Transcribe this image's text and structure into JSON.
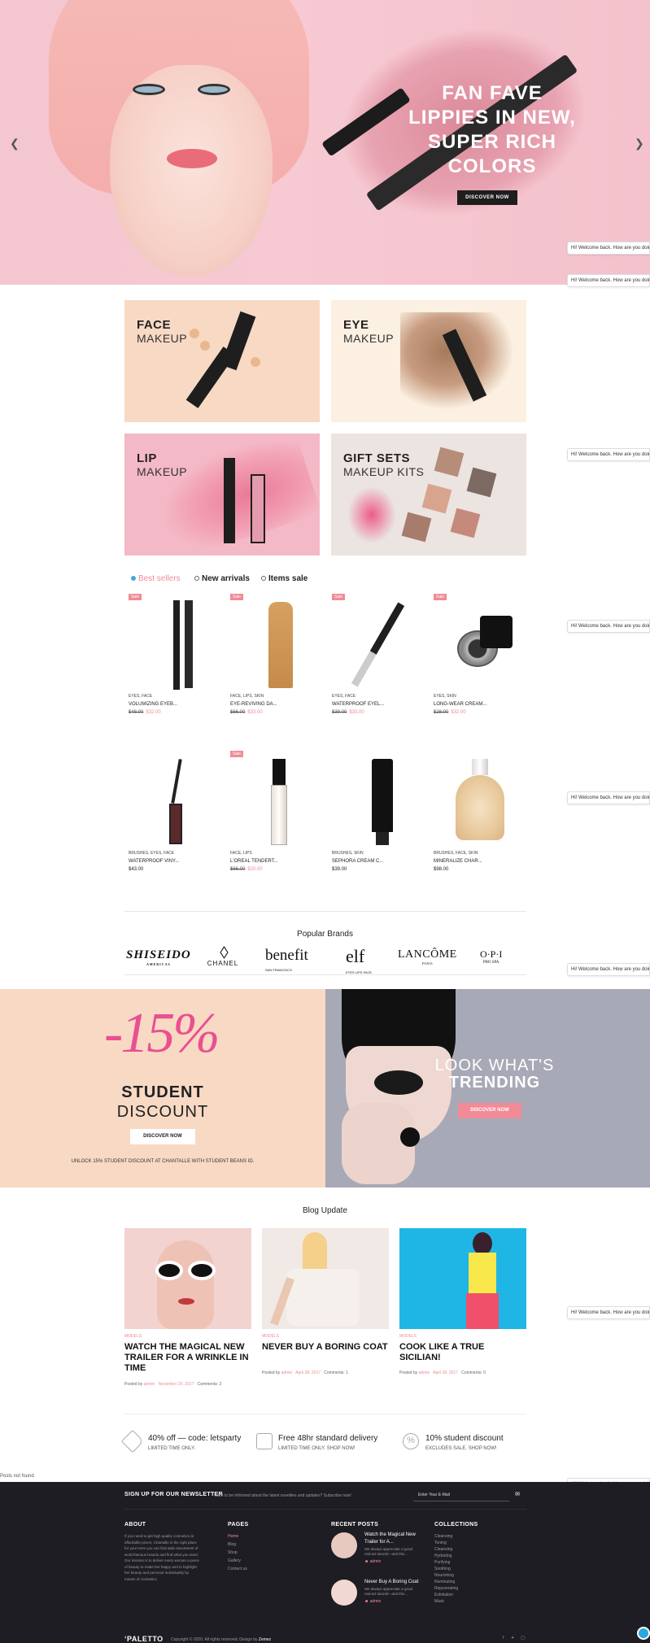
{
  "hero": {
    "title_lines": [
      "FAN FAVE",
      "LIPPIES IN NEW,",
      "SUPER RICH",
      "COLORS"
    ],
    "button": "DISCOVER NOW",
    "prev_icon": "chevron-left-icon",
    "next_icon": "chevron-right-icon"
  },
  "chat_text": "Hi! Welcome back. How are you doing?",
  "categories": [
    {
      "title": "FACE",
      "sub": "MAKEUP"
    },
    {
      "title": "EYE",
      "sub": "MAKEUP"
    },
    {
      "title": "LIP",
      "sub": "MAKEUP"
    },
    {
      "title": "GIFT SETS",
      "sub": "MAKEUP KITS"
    }
  ],
  "tabs": [
    {
      "label": "Best sellers",
      "active": true
    },
    {
      "label": "New arrivals",
      "active": false
    },
    {
      "label": "Items sale",
      "active": false
    }
  ],
  "sale_badge": "Sale",
  "products": [
    {
      "cat": "EYES, FACE",
      "name": "VOLUMIZING EYEB...",
      "old": "$48.00",
      "price": "$32.00",
      "sale": true
    },
    {
      "cat": "FACE, LIPS, SKIN",
      "name": "EYE-REVIVING DA...",
      "old": "$66.00",
      "price": "$33.00",
      "sale": true
    },
    {
      "cat": "EYES, FACE",
      "name": "WATERPROOF EYEL...",
      "old": "$39.00",
      "price": "$33.00",
      "sale": true
    },
    {
      "cat": "EYES, SKIN",
      "name": "LONG-WEAR CREAM...",
      "old": "$28.00",
      "price": "$32.00",
      "sale": true
    },
    {
      "cat": "BRUSHES, EYES, FACE",
      "name": "WATERPROOF VINY...",
      "old": "",
      "price": "$43.00",
      "sale": false
    },
    {
      "cat": "FACE, LIPS",
      "name": "L'OREAL TENDERT...",
      "old": "$66.00",
      "price": "$20.00",
      "sale": true
    },
    {
      "cat": "BRUSHES, SKIN",
      "name": "SEPHORA CREAM C...",
      "old": "",
      "price": "$39.00",
      "sale": false
    },
    {
      "cat": "BRUSHES, FACE, SKIN",
      "name": "MINERALIZE CHAR...",
      "old": "",
      "price": "$98.00",
      "sale": false
    }
  ],
  "brands": {
    "heading": "Popular Brands",
    "items": [
      {
        "name": "SHISEIDO",
        "sub": "AMERICAS"
      },
      {
        "name": "CHANEL",
        "sub": ""
      },
      {
        "name": "benefit",
        "sub": "SAN FRANCISCO"
      },
      {
        "name": "elf",
        "sub": "EYES LIPS FACE"
      },
      {
        "name": "LANCÔME",
        "sub": "PARIS"
      },
      {
        "name": "O·P·I",
        "sub": "PRO SPA"
      }
    ]
  },
  "promo": {
    "percent": "-15%",
    "title": "STUDENT",
    "subtitle": "DISCOUNT",
    "button": "DISCOVER NOW",
    "note": "UNLOCK 15% STUDENT DISCOUNT AT CHANTALLE WITH STUDENT BEANS ID.",
    "right_title": "LOOK WHAT'S",
    "right_title_bold": "TRENDING",
    "right_button": "DISCOVER NOW"
  },
  "blog": {
    "heading": "Blog Update",
    "posts": [
      {
        "cat": "MODELS",
        "title": "WATCH THE MAGICAL NEW TRAILER FOR A WRINKLE IN TIME",
        "by": "Posted by",
        "author": "admin",
        "date": "November 20, 2017",
        "comments": "Comments: 2"
      },
      {
        "cat": "MODELS",
        "title": "NEVER BUY A BORING COAT",
        "by": "Posted by",
        "author": "admin",
        "date": "April 28, 2017",
        "comments": "Comments: 1"
      },
      {
        "cat": "MODELS",
        "title": "COOK LIKE A TRUE SICILIAN!",
        "by": "Posted by",
        "author": "admin",
        "date": "April 28, 2017",
        "comments": "Comments: 0"
      }
    ]
  },
  "features": [
    {
      "title": "40% off — code: letsparty",
      "sub": "LIMITED TIME ONLY.",
      "icon": "tag-icon"
    },
    {
      "title": "Free 48hr standard delivery",
      "sub": "LIMITED TIME ONLY. SHOP NOW!",
      "icon": "gift-icon"
    },
    {
      "title": "10% student discount",
      "sub": "EXCLUDES SALE. SHOP NOW!",
      "icon": "percent-icon"
    }
  ],
  "posts_not_found": "Posts not found",
  "footer": {
    "newsletter_label": "SIGN UP FOR OUR NEWSLETTER",
    "newsletter_text": "Want to be informed about the latest novelties and updates? Subscribe now!",
    "email_placeholder": "Enter Your E-Mail",
    "about_head": "ABOUT",
    "about_text": "If you need to get high quality cosmetics at affordable prices, Chantalle is the right place for you! Here you can find wide assortment of world-famous brands and find what you need. Our mission is to deliver every woman a piece of beauty to make her happy and to highlight her beauty and personal individuality by means of cosmetics.",
    "pages_head": "PAGES",
    "pages": [
      "Home",
      "Blog",
      "Shop",
      "Gallery",
      "Contact us"
    ],
    "recent_head": "RECENT POSTS",
    "recent": [
      {
        "title": "Watch the Magical New Trailer for A...",
        "excerpt": "We always appreciate a good real-art tutorial—and this...",
        "author": "admin"
      },
      {
        "title": "Never Buy A Boring Coat",
        "excerpt": "We always appreciate a good real-art tutorial—and this...",
        "author": "admin"
      }
    ],
    "collections_head": "COLLECTIONS",
    "collections": [
      "Cleansing",
      "Toning",
      "Cleansing",
      "Hydrating",
      "Purifying",
      "Soothing",
      "Nourishing",
      "Illuminating",
      "Rejuvenating",
      "Exfoliation",
      "Mask"
    ],
    "logo": "PALETTO",
    "copyright": "Copyright © 2020. All rights reserved. Design by",
    "designer": "Zemez"
  },
  "colors": {
    "accent": "#f08b97",
    "dark": "#1d1d23",
    "hero_bg": "#f4c6cf"
  }
}
